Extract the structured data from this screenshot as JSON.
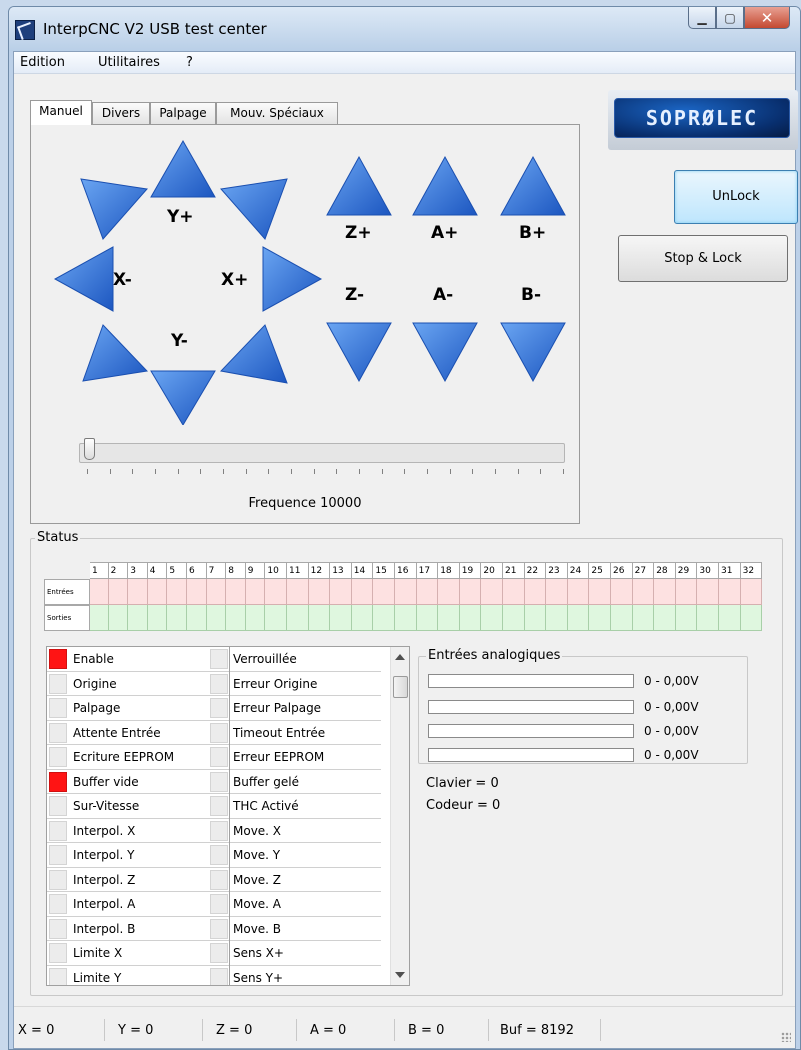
{
  "window": {
    "title": "InterpCNC V2 USB test center"
  },
  "menu": [
    "Edition",
    "Utilitaires",
    "?"
  ],
  "tabs": [
    "Manuel",
    "Divers",
    "Palpage",
    "Mouv. Spéciaux"
  ],
  "jog": {
    "labels": {
      "yplus": "Y+",
      "yminus": "Y-",
      "xminus": "X-",
      "xplus": "X+",
      "zplus": "Z+",
      "aplus": "A+",
      "bplus": "B+",
      "zminus": "Z-",
      "aminus": "A-",
      "bminus": "B-"
    },
    "arrow_color": "#2f6fd6"
  },
  "frequency": {
    "label": "Fréquence 10000",
    "text": "Frequence 10000"
  },
  "logo": {
    "text": "SOPRØLEC"
  },
  "buttons": {
    "unlock": "UnLock",
    "stop_lock": "Stop & Lock"
  },
  "status": {
    "group_label": "Status",
    "bit_columns": [
      "1",
      "2",
      "3",
      "4",
      "5",
      "6",
      "7",
      "8",
      "9",
      "10",
      "11",
      "12",
      "13",
      "14",
      "15",
      "16",
      "17",
      "18",
      "19",
      "20",
      "21",
      "22",
      "23",
      "24",
      "25",
      "26",
      "27",
      "28",
      "29",
      "30",
      "31",
      "32"
    ],
    "rows": {
      "inputs": "Entrées",
      "outputs": "Sorties"
    },
    "list": [
      {
        "left": "Enable",
        "left_on": true,
        "right": "Verrouillée"
      },
      {
        "left": "Origine",
        "left_on": false,
        "right": "Erreur Origine"
      },
      {
        "left": "Palpage",
        "left_on": false,
        "right": "Erreur Palpage"
      },
      {
        "left": "Attente Entrée",
        "left_on": false,
        "right": "Timeout Entrée"
      },
      {
        "left": "Ecriture EEPROM",
        "left_on": false,
        "right": "Erreur EEPROM"
      },
      {
        "left": "Buffer vide",
        "left_on": true,
        "right": "Buffer gelé"
      },
      {
        "left": "Sur-Vitesse",
        "left_on": false,
        "right": "THC Activé"
      },
      {
        "left": "Interpol. X",
        "left_on": false,
        "right": "Move. X"
      },
      {
        "left": "Interpol. Y",
        "left_on": false,
        "right": "Move. Y"
      },
      {
        "left": "Interpol. Z",
        "left_on": false,
        "right": "Move. Z"
      },
      {
        "left": "Interpol. A",
        "left_on": false,
        "right": "Move. A"
      },
      {
        "left": "Interpol. B",
        "left_on": false,
        "right": "Move. B"
      },
      {
        "left": "Limite X",
        "left_on": false,
        "right": "Sens X+"
      },
      {
        "left": "Limite Y",
        "left_on": false,
        "right": "Sens Y+"
      }
    ],
    "led_on_color": "#ff1414",
    "analog": {
      "label": "Entrées analogiques",
      "values": [
        "0 - 0,00V",
        "0 - 0,00V",
        "0 - 0,00V",
        "0 - 0,00V"
      ]
    },
    "clavier": "Clavier = 0",
    "codeur": "Codeur = 0"
  },
  "statusbar": [
    "X = 0",
    "Y = 0",
    "Z = 0",
    "A = 0",
    "B = 0",
    "Buf = 8192"
  ]
}
